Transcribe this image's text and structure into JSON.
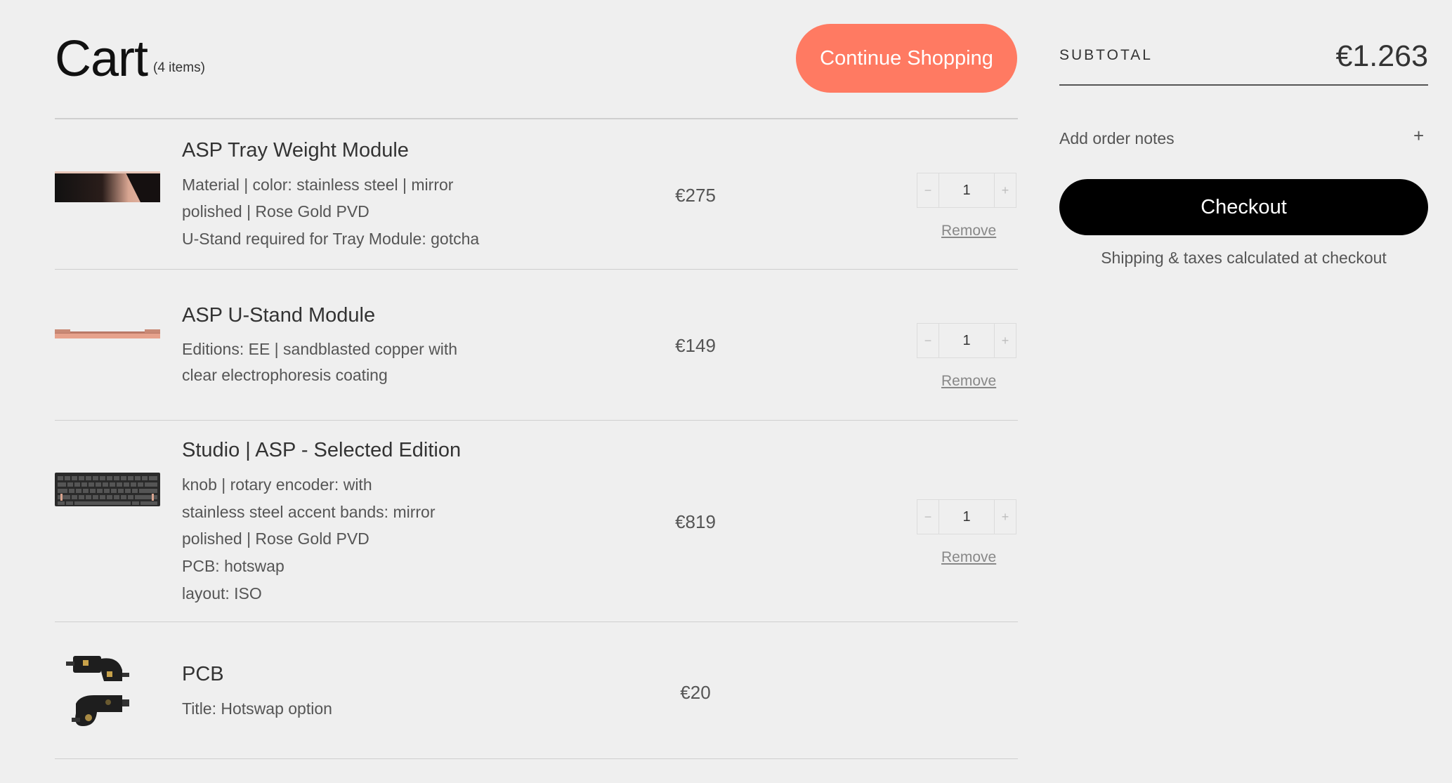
{
  "header": {
    "title": "Cart",
    "count": "(4 items)",
    "continue_label": "Continue Shopping"
  },
  "items": [
    {
      "name": "ASP Tray Weight Module",
      "lines": [
        "Material | color: stainless steel | mirror",
        "polished | Rose Gold PVD",
        "U-Stand required for Tray Module: gotcha"
      ],
      "price": "€275",
      "qty": "1",
      "remove": "Remove"
    },
    {
      "name": "ASP U-Stand Module",
      "lines": [
        "Editions: EE | sandblasted copper with",
        "clear electrophoresis coating"
      ],
      "price": "€149",
      "qty": "1",
      "remove": "Remove"
    },
    {
      "name": "Studio | ASP - Selected Edition",
      "lines": [
        "knob | rotary encoder: with",
        "stainless steel accent bands: mirror",
        "polished | Rose Gold PVD",
        "PCB: hotswap",
        "layout: ISO"
      ],
      "price": "€819",
      "qty": "1",
      "remove": "Remove"
    },
    {
      "name": "PCB",
      "lines": [
        "Title: Hotswap option"
      ],
      "price": "€20"
    }
  ],
  "qty_controls": {
    "minus": "−",
    "plus": "+"
  },
  "summary": {
    "subtotal_label": "SUBTOTAL",
    "subtotal_value": "€1.263",
    "notes_label": "Add order notes",
    "notes_plus": "+",
    "checkout_label": "Checkout",
    "shipping_note": "Shipping & taxes calculated at checkout"
  },
  "colors": {
    "accent": "#ff7a62",
    "checkout": "#000000",
    "background": "#efefef"
  }
}
